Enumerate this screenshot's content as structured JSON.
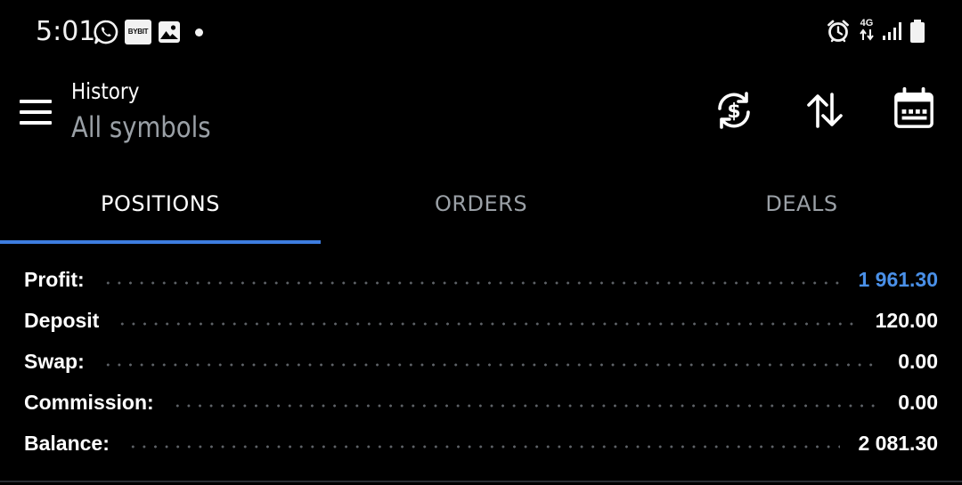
{
  "status_bar": {
    "time": "5:01",
    "notification_icons": [
      "whatsapp-icon",
      "bybit-icon",
      "gallery-icon",
      "dot-icon"
    ],
    "bybit_label": "BYBIT",
    "network_label": "4G",
    "system_icons": [
      "alarm-icon",
      "network-4g-icon",
      "signal-icon",
      "battery-icon"
    ]
  },
  "app_bar": {
    "title": "History",
    "subtitle": "All symbols",
    "actions": [
      "currency-refresh-icon",
      "sort-icon",
      "calendar-icon"
    ]
  },
  "tabs": [
    {
      "label": "POSITIONS",
      "active": true
    },
    {
      "label": "ORDERS",
      "active": false
    },
    {
      "label": "DEALS",
      "active": false
    }
  ],
  "summary": [
    {
      "label": "Profit:",
      "value": "1 961.30"
    },
    {
      "label": "Deposit",
      "value": "120.00"
    },
    {
      "label": "Swap:",
      "value": "0.00"
    },
    {
      "label": "Commission:",
      "value": "0.00"
    },
    {
      "label": "Balance:",
      "value": "2 081.30"
    }
  ],
  "colors": {
    "background": "#000000",
    "accent": "#3d7de0",
    "profit": "#4a90e8",
    "secondary_text": "#9aa0a6"
  }
}
